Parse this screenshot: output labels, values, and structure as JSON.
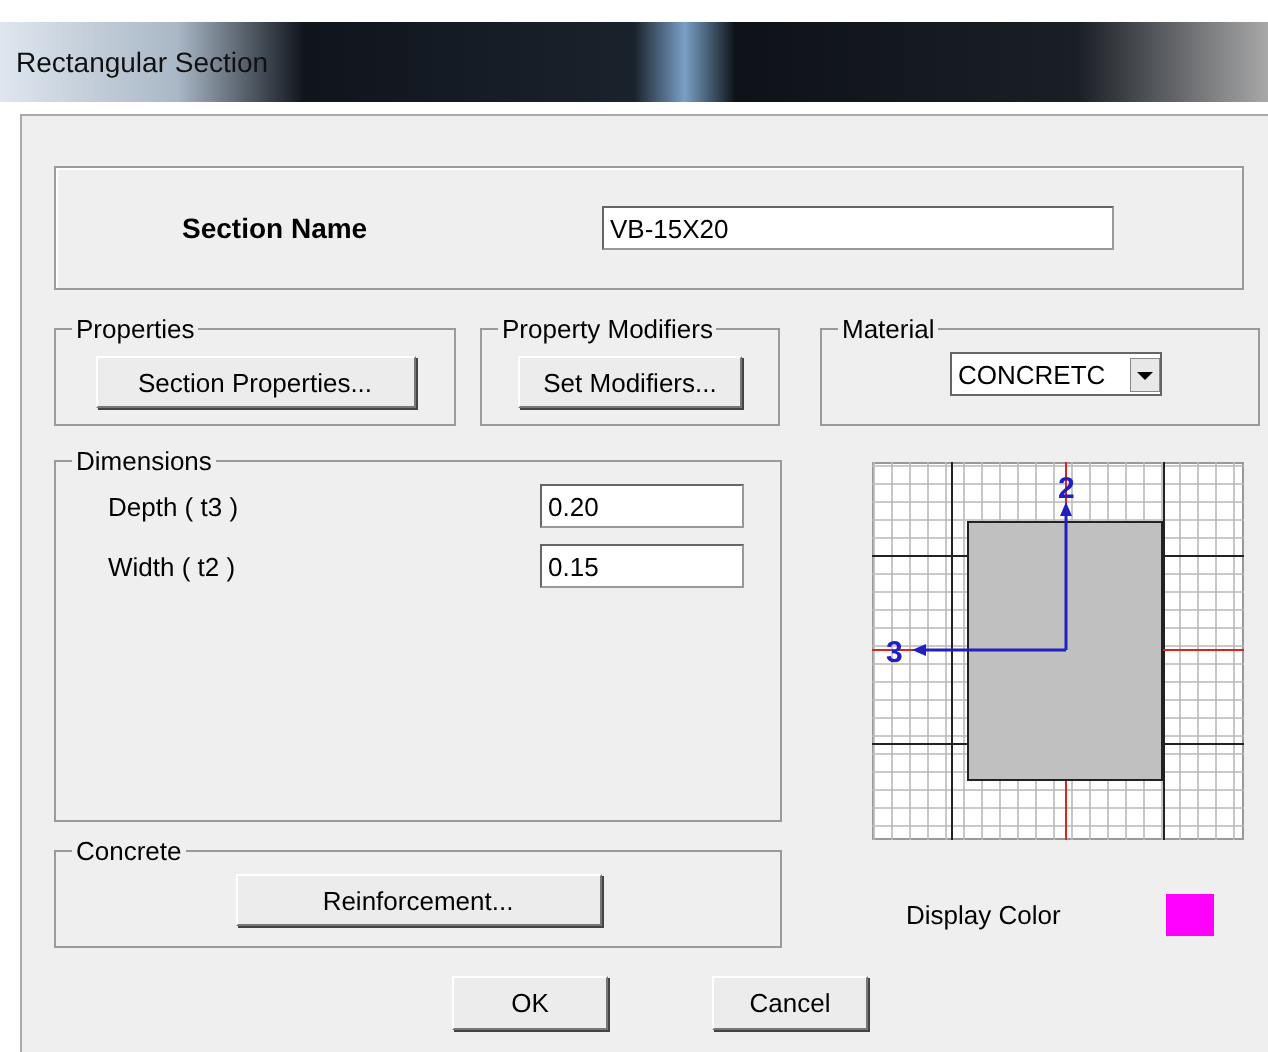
{
  "window": {
    "title": "Rectangular Section"
  },
  "section_name": {
    "label": "Section Name",
    "value": "VB-15X20"
  },
  "properties": {
    "legend": "Properties",
    "button": "Section Properties..."
  },
  "property_modifiers": {
    "legend": "Property Modifiers",
    "button": "Set Modifiers..."
  },
  "material": {
    "legend": "Material",
    "value": "CONCRETC"
  },
  "dimensions": {
    "legend": "Dimensions",
    "fields": [
      {
        "label": "Depth  ( t3 )",
        "value": "0.20"
      },
      {
        "label": "Width  ( t2 )",
        "value": "0.15"
      }
    ]
  },
  "concrete": {
    "legend": "Concrete",
    "button": "Reinforcement..."
  },
  "preview": {
    "axis_labels": [
      "2",
      "3"
    ]
  },
  "display_color": {
    "label": "Display Color",
    "color": "#ff00ff"
  },
  "buttons": [
    "OK",
    "Cancel"
  ]
}
